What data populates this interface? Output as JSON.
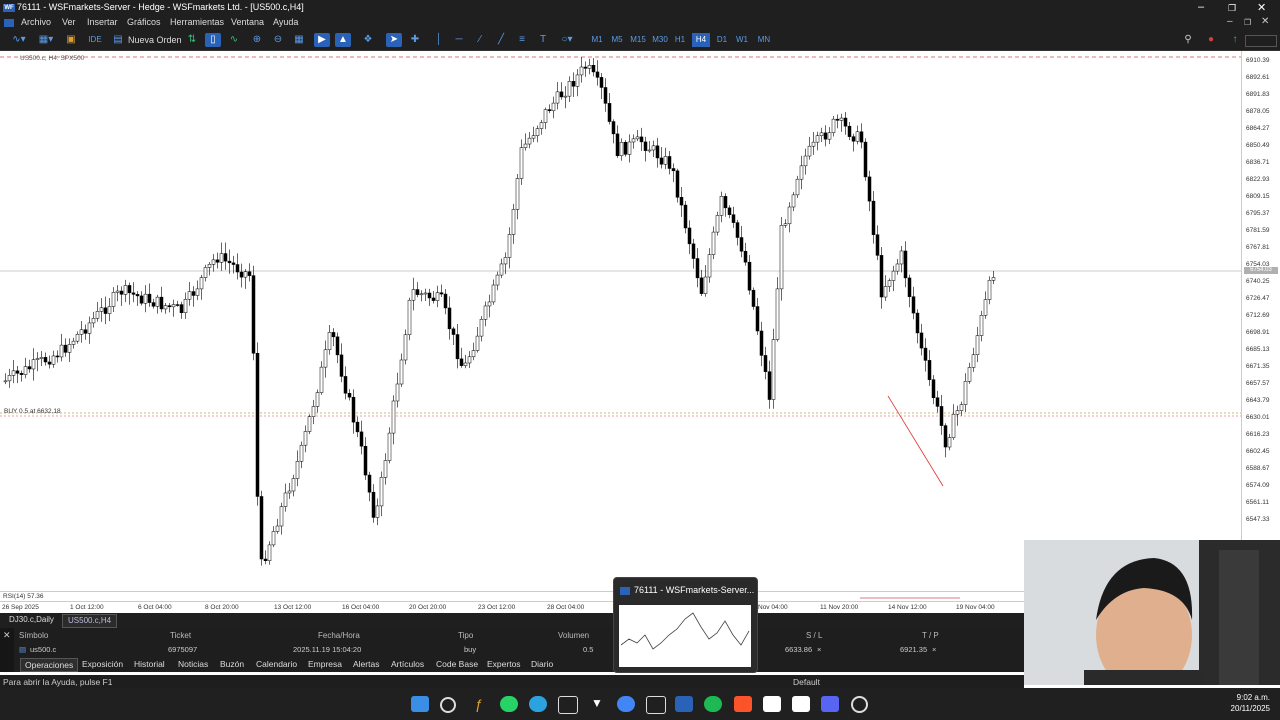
{
  "window": {
    "title": "76111 - WSFmarkets-Server - Hedge - WSFmarkets Ltd. - [US500.c,H4]",
    "app_icon": "WF"
  },
  "menu": [
    "Archivo",
    "Ver",
    "Insertar",
    "Gráficos",
    "Herramientas",
    "Ventana",
    "Ayuda"
  ],
  "toolbar": {
    "new_order": "Nueva Orden",
    "ide": "IDE",
    "timeframes": [
      "M1",
      "M5",
      "M15",
      "M30",
      "H1",
      "H4",
      "D1",
      "W1",
      "MN"
    ],
    "active_timeframe": "H4"
  },
  "chart": {
    "label": "US500.c, H4:  SPX500",
    "buy_label": "BUY 0.5 at 6632.18",
    "current_price_label": "6754.03",
    "rsi_label": "RSI(14) 57.36",
    "y_labels": [
      "6910.39",
      "6892.61",
      "6891.83",
      "6878.05",
      "6864.27",
      "6850.49",
      "6836.71",
      "6822.93",
      "6809.15",
      "6795.37",
      "6781.59",
      "6767.81",
      "6754.03",
      "6740.25",
      "6726.47",
      "6712.69",
      "6698.91",
      "6685.13",
      "6671.35",
      "6657.57",
      "6643.79",
      "6630.01",
      "6616.23",
      "6602.45",
      "6588.67",
      "6574.09",
      "6561.11",
      "6547.33"
    ],
    "x_labels": [
      "26 Sep 2025",
      "1 Oct 12:00",
      "6 Oct 04:00",
      "8 Oct 20:00",
      "13 Oct 12:00",
      "16 Oct 04:00",
      "20 Oct 20:00",
      "23 Oct 12:00",
      "28 Oct 04:00",
      "Nov 04:00",
      "11 Nov 20:00",
      "14 Nov 12:00",
      "19 Nov 04:00"
    ]
  },
  "chart_tabs": [
    "DJ30.c,Daily",
    "US500.c,H4"
  ],
  "active_chart_tab": "US500.c,H4",
  "trade_table": {
    "headers": [
      "Símbolo",
      "Ticket",
      "Fecha/Hora",
      "Tipo",
      "Volumen",
      "S / L",
      "T / P"
    ],
    "row": {
      "symbol": "us500.c",
      "ticket": "6975097",
      "datetime": "2025.11.19 15:04:20",
      "type": "buy",
      "volume": "0.5",
      "sl": "6633.86",
      "tp": "6921.35",
      "close_sl": "×",
      "close_tp": "×"
    }
  },
  "bottom_tabs": [
    "Operaciones",
    "Exposición",
    "Historial",
    "Noticias",
    "Buzón",
    "Calendario",
    "Empresa",
    "Alertas",
    "Artículos",
    "Code Base",
    "Expertos",
    "Diario"
  ],
  "status": {
    "help": "Para abrir la Ayuda, pulse F1",
    "profile": "Default"
  },
  "popup": {
    "title": "76111 - WSFmarkets-Server..."
  },
  "taskbar": {
    "time": "9:02 a.m.",
    "date": "20/11/2025",
    "icons": [
      "windows-icon",
      "search-icon",
      "fx-icon",
      "whatsapp-icon",
      "telegram-icon",
      "calendar-icon",
      "tradingview-icon",
      "chrome-icon",
      "app-icon",
      "metatrader-icon",
      "spotify-icon",
      "brave-icon",
      "gtc-icon",
      "notion-icon",
      "discord-icon",
      "speed-icon"
    ],
    "colors": {
      "bg": "#202020"
    }
  },
  "colors": {
    "accent": "#2a62b8",
    "bull": "#ffffff",
    "bear": "#000000",
    "buy_line": "#c8a040",
    "sl_line": "#c05050"
  }
}
